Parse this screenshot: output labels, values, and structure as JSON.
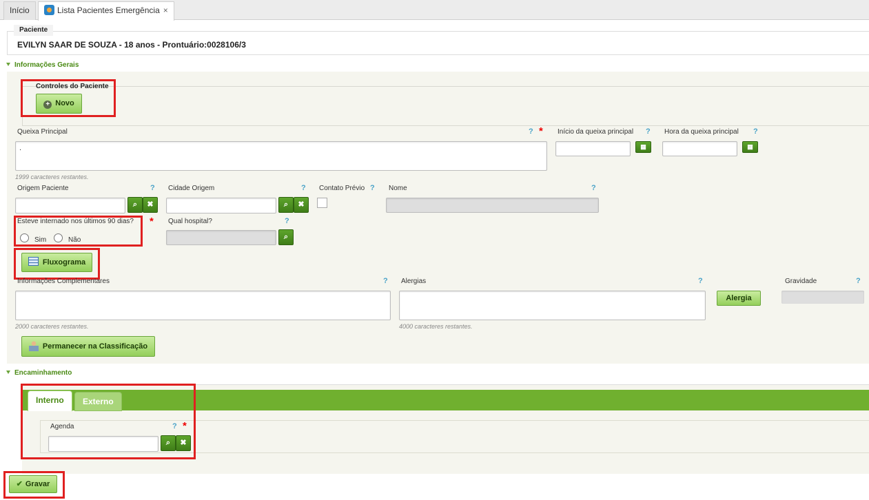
{
  "tabs": {
    "home": "Início",
    "active": "Lista Pacientes Emergência",
    "close": "×"
  },
  "patient": {
    "legend": "Paciente",
    "name": "EVILYN SAAR DE SOUZA - 18 anos - Prontuário:0028106/3"
  },
  "sections": {
    "general": "Informações Gerais",
    "referral": "Encaminhamento"
  },
  "controls": {
    "legend": "Controles do Paciente",
    "new_button": "Novo"
  },
  "form": {
    "main_complaint": {
      "label": "Queixa Principal",
      "value": ".",
      "remaining": "1999 caracteres restantes."
    },
    "complaint_start": {
      "label": "Início da queixa principal",
      "value": ""
    },
    "complaint_time": {
      "label": "Hora da queixa principal",
      "value": ""
    },
    "origin": {
      "label": "Origem Paciente",
      "value": ""
    },
    "origin_city": {
      "label": "Cidade Origem",
      "value": ""
    },
    "prior_contact": {
      "label": "Contato Prévio"
    },
    "name": {
      "label": "Nome",
      "value": ""
    },
    "hospitalized": {
      "label": "Esteve internado nos últimos 90 dias?",
      "yes": "Sim",
      "no": "Não"
    },
    "which_hospital": {
      "label": "Qual hospital?",
      "value": ""
    },
    "flowchart_button": "Fluxograma",
    "complementary": {
      "label": "Informações Complementares",
      "value": "",
      "remaining": "2000 caracteres restantes."
    },
    "allergies": {
      "label": "Alergias",
      "value": "",
      "remaining": "4000 caracteres restantes."
    },
    "allergy_button": "Alergia",
    "severity": {
      "label": "Gravidade",
      "value": ""
    },
    "stay_button": "Permanecer na Classificação",
    "help": "?",
    "required": "*"
  },
  "referral": {
    "tab_internal": "Interno",
    "tab_external": "Externo",
    "schedule": {
      "label": "Agenda",
      "value": ""
    }
  },
  "footer": {
    "save_button": "Gravar"
  },
  "icons": {
    "search": "search-icon",
    "clear": "clear-icon",
    "calendar": "calendar-icon",
    "plus": "plus-circle-icon",
    "check": "check-icon",
    "table": "table-icon",
    "person": "person-icon"
  },
  "colors": {
    "accent_green": "#70b02f",
    "section_green": "#4a8a14",
    "highlight_red": "#e02020",
    "help_blue": "#4aa3c8",
    "required_red": "#ee0000"
  }
}
